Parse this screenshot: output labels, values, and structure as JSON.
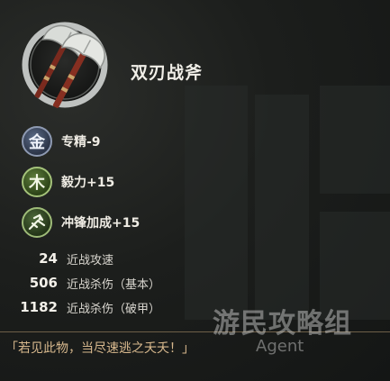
{
  "item": {
    "name": "双刃战斧",
    "icon": "double-battle-axe-icon"
  },
  "stats": [
    {
      "badge": "金",
      "text": "专精-9",
      "icon": "metal-element-icon"
    },
    {
      "badge": "木",
      "text": "毅力+15",
      "icon": "wood-element-icon"
    },
    {
      "badge": "",
      "text": "冲锋加成+15",
      "icon": "charge-bonus-icon"
    }
  ],
  "numbers": [
    {
      "value": "24",
      "label": "近战攻速"
    },
    {
      "value": "506",
      "label": "近战杀伤（基本）"
    },
    {
      "value": "1182",
      "label": "近战杀伤（破甲）"
    }
  ],
  "flavor_text": "「若见此物，当尽速逃之夭夭！」",
  "watermark": {
    "main": "游民攻略组",
    "sub": "Agent"
  },
  "colors": {
    "background": "#151716",
    "flavor_text": "#d7b88d",
    "divider": "#6e5f48"
  }
}
